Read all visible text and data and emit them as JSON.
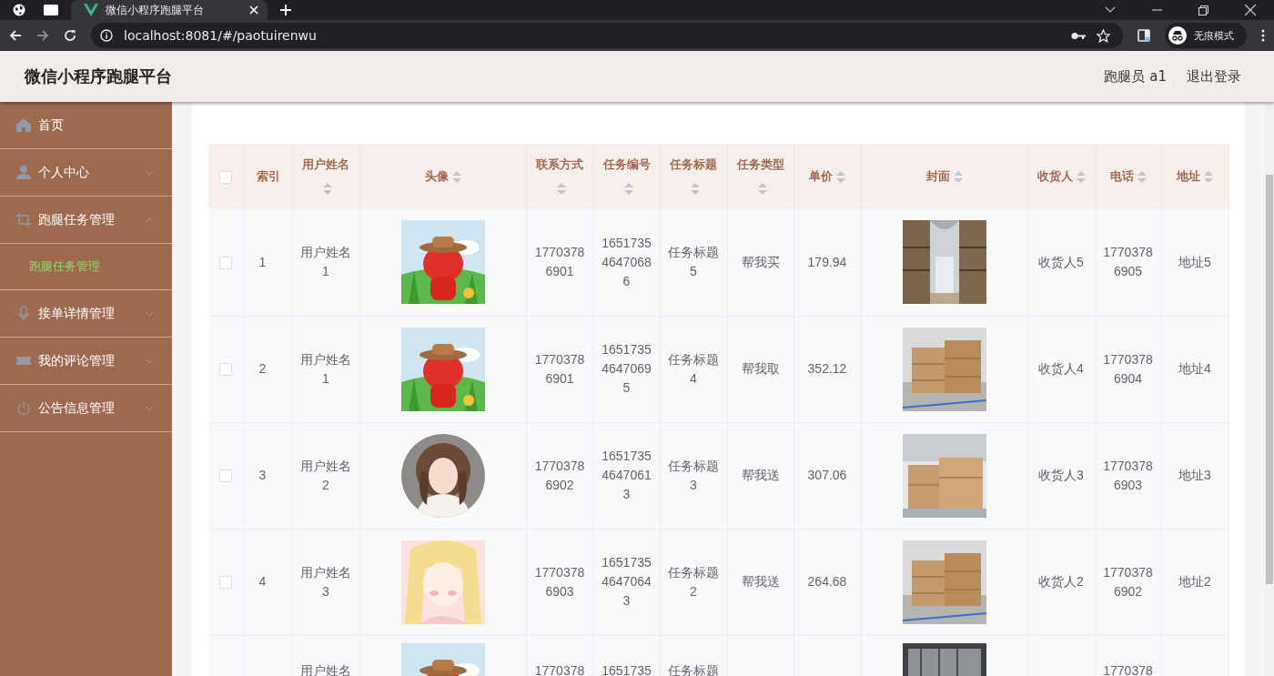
{
  "browser": {
    "tab_title": "微信小程序跑腿平台",
    "url": "localhost:8081/#/paotuirenwu",
    "profile_label": "无痕模式"
  },
  "header": {
    "title": "微信小程序跑腿平台",
    "user": "跑腿员 a1",
    "logout": "退出登录"
  },
  "sidebar": {
    "items": [
      {
        "kind": "link",
        "label": "首页",
        "selected": false
      },
      {
        "kind": "submenu",
        "label": "个人中心",
        "selected": false,
        "expanded": false
      },
      {
        "kind": "submenu",
        "label": "跑腿任务管理",
        "selected": false,
        "expanded": true,
        "children": [
          {
            "label": "跑腿任务管理",
            "selected": true
          }
        ]
      },
      {
        "kind": "submenu",
        "label": "接单详情管理",
        "selected": false,
        "expanded": false
      },
      {
        "kind": "submenu",
        "label": "我的评论管理",
        "selected": false,
        "expanded": false
      },
      {
        "kind": "submenu",
        "label": "公告信息管理",
        "selected": false,
        "expanded": false
      }
    ]
  },
  "table": {
    "select_all": {
      "checked": false
    },
    "columns": [
      {
        "label": "索引",
        "sortable": false
      },
      {
        "label": "用户姓名",
        "sortable": true
      },
      {
        "label": "头像",
        "sortable": true
      },
      {
        "label": "联系方式",
        "sortable": true
      },
      {
        "label": "任务编号",
        "sortable": true
      },
      {
        "label": "任务标题",
        "sortable": true
      },
      {
        "label": "任务类型",
        "sortable": true
      },
      {
        "label": "单价",
        "sortable": true
      },
      {
        "label": "封面",
        "sortable": true
      },
      {
        "label": "收货人",
        "sortable": true
      },
      {
        "label": "电话",
        "sortable": true
      },
      {
        "label": "地址",
        "sortable": true
      }
    ],
    "rows": [
      {
        "checked": false,
        "index": "1",
        "name": "用户姓名1",
        "phone": "17703786901",
        "task_no": "165173546470686",
        "title": "任务标题5",
        "type": "帮我买",
        "price": "179.94",
        "receiver": "收货人5",
        "receiver_phone": "17703786905",
        "address": "地址5"
      },
      {
        "checked": false,
        "index": "2",
        "name": "用户姓名1",
        "phone": "17703786901",
        "task_no": "165173546470695",
        "title": "任务标题4",
        "type": "帮我取",
        "price": "352.12",
        "receiver": "收货人4",
        "receiver_phone": "17703786904",
        "address": "地址4"
      },
      {
        "checked": false,
        "index": "3",
        "name": "用户姓名2",
        "phone": "17703786902",
        "task_no": "165173546470613",
        "title": "任务标题3",
        "type": "帮我送",
        "price": "307.06",
        "receiver": "收货人3",
        "receiver_phone": "17703786903",
        "address": "地址3"
      },
      {
        "checked": false,
        "index": "4",
        "name": "用户姓名3",
        "phone": "17703786903",
        "task_no": "165173546470643",
        "title": "任务标题2",
        "type": "帮我送",
        "price": "264.68",
        "receiver": "收货人2",
        "receiver_phone": "17703786902",
        "address": "地址2"
      },
      {
        "name": "用户姓名",
        "phone": "1770378",
        "task_no": "1651735",
        "title": "任务标题",
        "receiver_phone": "1770378"
      }
    ]
  }
}
